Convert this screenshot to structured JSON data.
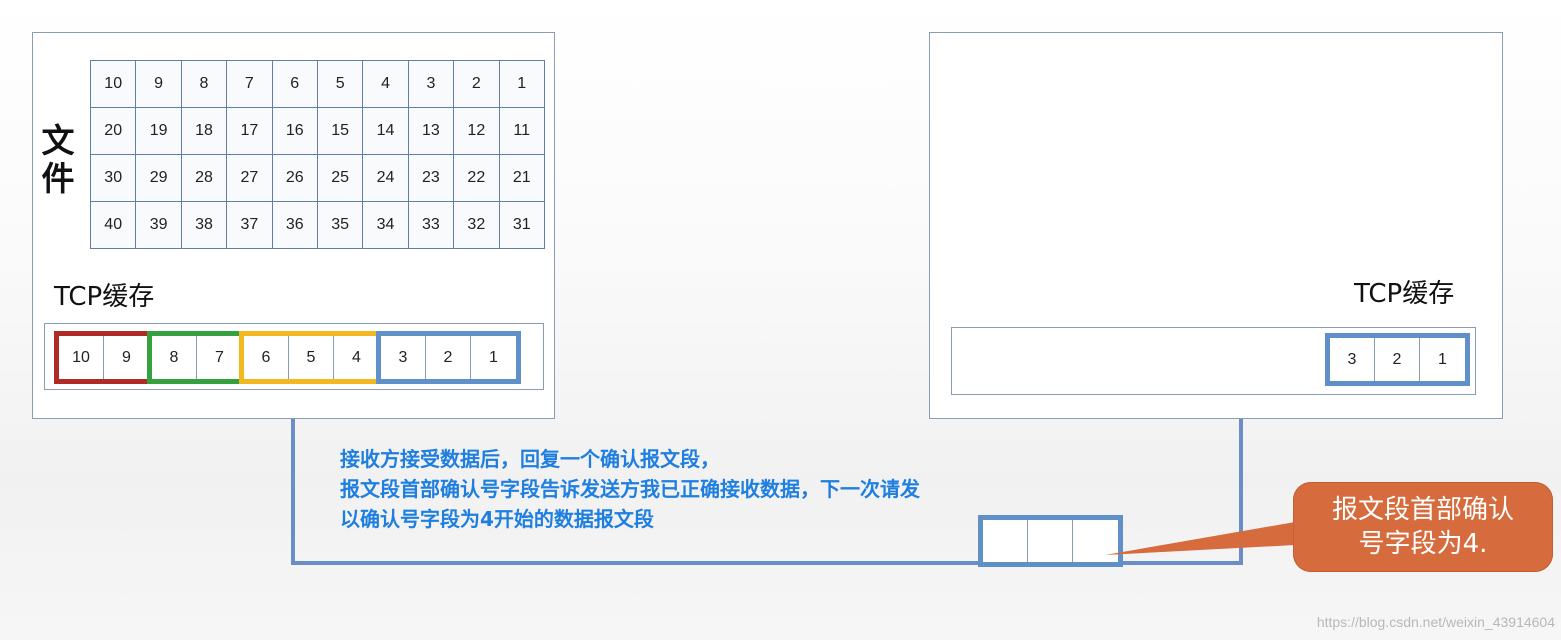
{
  "sender": {
    "file_label_line1": "文",
    "file_label_line2": "件",
    "file_rows": [
      [
        "10",
        "9",
        "8",
        "7",
        "6",
        "5",
        "4",
        "3",
        "2",
        "1"
      ],
      [
        "20",
        "19",
        "18",
        "17",
        "16",
        "15",
        "14",
        "13",
        "12",
        "11"
      ],
      [
        "30",
        "29",
        "28",
        "27",
        "26",
        "25",
        "24",
        "23",
        "22",
        "21"
      ],
      [
        "40",
        "39",
        "38",
        "37",
        "36",
        "35",
        "34",
        "33",
        "32",
        "31"
      ]
    ],
    "tcp_label": "TCP缓存",
    "buffer_groups": [
      {
        "color": "#b02a26",
        "cells": [
          "10",
          "9"
        ]
      },
      {
        "color": "#35a13e",
        "cells": [
          "8",
          "7"
        ]
      },
      {
        "color": "#f3b81f",
        "cells": [
          "6",
          "5",
          "4"
        ]
      },
      {
        "color": "#5f90c8",
        "cells": [
          "3",
          "2",
          "1"
        ]
      }
    ]
  },
  "receiver": {
    "tcp_label": "TCP缓存",
    "buffer_cells": [
      "3",
      "2",
      "1"
    ]
  },
  "explanation": {
    "line1": "接收方接受数据后，回复一个确认报文段，",
    "line2": "报文段首部确认号字段告诉发送方我已正确接收数据，下一次请发",
    "line3": "以确认号字段为4开始的数据报文段"
  },
  "callout": {
    "line1": "报文段首部确认",
    "line2": "号字段为4."
  },
  "watermark": "https://blog.csdn.net/weixin_43914604",
  "colors": {
    "red": "#b02a26",
    "green": "#35a13e",
    "yellow": "#f3b81f",
    "blue": "#5f90c8",
    "text_blue": "#1e7fe0",
    "callout": "#d66c3e"
  }
}
